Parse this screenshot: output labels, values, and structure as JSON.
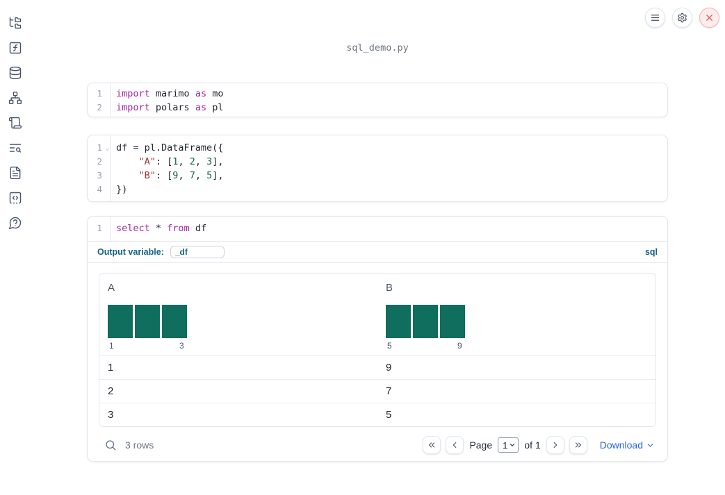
{
  "header": {
    "title": "sql_demo.py",
    "action_icons": [
      "menu-icon",
      "gear-icon",
      "close-icon"
    ]
  },
  "sidebar": {
    "items": [
      {
        "id": "file-explorer",
        "icon": "folder-tree"
      },
      {
        "id": "functions",
        "icon": "function-square"
      },
      {
        "id": "datasources",
        "icon": "database"
      },
      {
        "id": "dependencies",
        "icon": "network"
      },
      {
        "id": "scratchpad",
        "icon": "scroll"
      },
      {
        "id": "logs",
        "icon": "text-search"
      },
      {
        "id": "documentation",
        "icon": "file-text"
      },
      {
        "id": "snippets",
        "icon": "code-square"
      },
      {
        "id": "help",
        "icon": "help-chat"
      }
    ]
  },
  "cells": [
    {
      "name": "imports-cell",
      "lines": [
        {
          "n": "1",
          "tokens": [
            [
              "kw",
              "import"
            ],
            [
              "t",
              " marimo "
            ],
            [
              "kw",
              "as"
            ],
            [
              "t",
              " mo"
            ]
          ]
        },
        {
          "n": "2",
          "tokens": [
            [
              "kw",
              "import"
            ],
            [
              "t",
              " polars "
            ],
            [
              "kw",
              "as"
            ],
            [
              "t",
              " pl"
            ]
          ]
        }
      ]
    },
    {
      "name": "dataframe-cell",
      "lines": [
        {
          "n": "1",
          "fold": true,
          "tokens": [
            [
              "t",
              "df = pl.DataFrame({"
            ]
          ]
        },
        {
          "n": "2",
          "tokens": [
            [
              "t",
              "    "
            ],
            [
              "s",
              "\"A\""
            ],
            [
              "t",
              ": ["
            ],
            [
              "n1",
              "1"
            ],
            [
              "t",
              ", "
            ],
            [
              "n1",
              "2"
            ],
            [
              "t",
              ", "
            ],
            [
              "n1",
              "3"
            ],
            [
              "t",
              "],"
            ]
          ]
        },
        {
          "n": "3",
          "tokens": [
            [
              "t",
              "    "
            ],
            [
              "s",
              "\"B\""
            ],
            [
              "t",
              ": ["
            ],
            [
              "n1",
              "9"
            ],
            [
              "t",
              ", "
            ],
            [
              "n1",
              "7"
            ],
            [
              "t",
              ", "
            ],
            [
              "n1",
              "5"
            ],
            [
              "t",
              "],"
            ]
          ]
        },
        {
          "n": "4",
          "tokens": [
            [
              "t",
              "})"
            ]
          ]
        }
      ]
    },
    {
      "name": "sql-cell",
      "lines": [
        {
          "n": "1",
          "tokens": [
            [
              "kw",
              "select"
            ],
            [
              "t",
              " * "
            ],
            [
              "kw",
              "from"
            ],
            [
              "t",
              " df"
            ]
          ]
        }
      ],
      "output_variable_label": "Output variable:",
      "output_variable_value": "_df",
      "language_badge": "sql"
    }
  ],
  "table": {
    "columns": [
      {
        "name": "A",
        "hist": {
          "type": "bar",
          "values": [
            1,
            1,
            1
          ],
          "edge_labels": [
            "1",
            "3"
          ]
        }
      },
      {
        "name": "B",
        "hist": {
          "type": "bar",
          "values": [
            1,
            1,
            1
          ],
          "edge_labels": [
            "5",
            "9"
          ]
        }
      }
    ],
    "rows": [
      [
        "1",
        "9"
      ],
      [
        "2",
        "7"
      ],
      [
        "3",
        "5"
      ]
    ],
    "footer": {
      "row_count": "3 rows",
      "page_label": "Page",
      "page_value": "1",
      "page_total": "of 1",
      "download_label": "Download"
    }
  },
  "colors": {
    "histogram_bar": "#0f6e5d",
    "code_keyword": "#a626a4",
    "code_string": "#a83232",
    "code_number": "#116644",
    "label_blue": "#156385",
    "link_blue": "#2563eb",
    "close_red": "#dc5a5a"
  }
}
